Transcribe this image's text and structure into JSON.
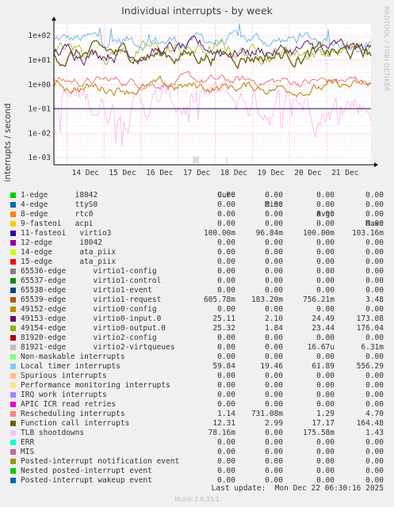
{
  "chart_data": {
    "type": "line",
    "title": "Individual interrupts - by week",
    "ylabel": "interrupts / second",
    "yscale": "log",
    "ylim": [
      0.0005,
      300
    ],
    "yticks": [
      "1e-03",
      "1e-02",
      "1e-01",
      "1e+00",
      "1e+01",
      "1e+02"
    ],
    "x_categories": [
      "14 Dec",
      "15 Dec",
      "16 Dec",
      "17 Dec",
      "18 Dec",
      "19 Dec",
      "20 Dec",
      "21 Dec"
    ],
    "grid": true,
    "legend_placement": "bottom",
    "series_traces": [
      {
        "name": "Local timer interrupts",
        "color": "#7ab6e8",
        "typical": 61.89,
        "noise": 0.18,
        "spike_max": 556.29
      },
      {
        "name": "TLB shootdowns",
        "color": "#ffbef0",
        "typical": 0.18,
        "noise": 0.45,
        "dips": true
      },
      {
        "name": "Rescheduling interrupts",
        "color": "#e9797a",
        "typical": 1.29,
        "noise": 0.14
      },
      {
        "name": "virtio0-output.0",
        "color": "#a8c447",
        "typical": 23.44,
        "noise": 0.22
      },
      {
        "name": "virtio0-input.0",
        "color": "#5d1c72",
        "typical": 24.49,
        "noise": 0.2
      },
      {
        "name": "Function call interrupts",
        "color": "#6f6417",
        "typical": 17.17,
        "noise": 0.22
      },
      {
        "name": "virtio1-request",
        "color": "#b5820a",
        "typical": 0.7562,
        "noise": 0.15
      },
      {
        "name": "virtio3",
        "color": "#1f0e63",
        "typical": 0.1,
        "noise": 0.0
      }
    ]
  },
  "legend_header": {
    "cur": "Cur:",
    "min": "Min:",
    "avg": "Avg:",
    "max": "Max:"
  },
  "legend": [
    {
      "name": "1-edge      i8042",
      "color": "#00cc00",
      "cur": "0.00",
      "min": "0.00",
      "avg": "0.00",
      "max": "0.00"
    },
    {
      "name": "4-edge      ttyS0",
      "color": "#0066b3",
      "cur": "0.00",
      "min": "0.00",
      "avg": "0.00",
      "max": "0.00"
    },
    {
      "name": "8-edge      rtc0",
      "color": "#ff8000",
      "cur": "0.00",
      "min": "0.00",
      "avg": "0.00",
      "max": "0.00"
    },
    {
      "name": "9-fasteoi   acpi",
      "color": "#ffcc00",
      "cur": "0.00",
      "min": "0.00",
      "avg": "0.00",
      "max": "0.00"
    },
    {
      "name": "11-fasteoi   virtio3",
      "color": "#330099",
      "cur": "100.00m",
      "min": "96.84m",
      "avg": "100.00m",
      "max": "103.16m"
    },
    {
      "name": "12-edge      i8042",
      "color": "#990099",
      "cur": "0.00",
      "min": "0.00",
      "avg": "0.00",
      "max": "0.00"
    },
    {
      "name": "14-edge      ata_piix",
      "color": "#ccff00",
      "cur": "0.00",
      "min": "0.00",
      "avg": "0.00",
      "max": "0.00"
    },
    {
      "name": "15-edge      ata_piix",
      "color": "#ff0000",
      "cur": "0.00",
      "min": "0.00",
      "avg": "0.00",
      "max": "0.00"
    },
    {
      "name": "65536-edge      virtio1-config",
      "color": "#808080",
      "cur": "0.00",
      "min": "0.00",
      "avg": "0.00",
      "max": "0.00"
    },
    {
      "name": "65537-edge      virtio1-control",
      "color": "#008f00",
      "cur": "0.00",
      "min": "0.00",
      "avg": "0.00",
      "max": "0.00"
    },
    {
      "name": "65538-edge      virtio1-event",
      "color": "#00487d",
      "cur": "0.00",
      "min": "0.00",
      "avg": "0.00",
      "max": "0.00"
    },
    {
      "name": "65539-edge      virtio1-request",
      "color": "#b35a00",
      "cur": "605.78m",
      "min": "183.20m",
      "avg": "756.21m",
      "max": "3.48"
    },
    {
      "name": "49152-edge      virtio0-config",
      "color": "#b38f00",
      "cur": "0.00",
      "min": "0.00",
      "avg": "0.00",
      "max": "0.00"
    },
    {
      "name": "49153-edge      virtio0-input.0",
      "color": "#6b006b",
      "cur": "25.11",
      "min": "2.10",
      "avg": "24.49",
      "max": "173.08"
    },
    {
      "name": "49154-edge      virtio0-output.0",
      "color": "#8fb300",
      "cur": "25.32",
      "min": "1.84",
      "avg": "23.44",
      "max": "176.04"
    },
    {
      "name": "81920-edge      virtio2-config",
      "color": "#b30000",
      "cur": "0.00",
      "min": "0.00",
      "avg": "0.00",
      "max": "0.00"
    },
    {
      "name": "81921-edge      virtio2-virtqueues",
      "color": "#bebebe",
      "cur": "0.00",
      "min": "0.00",
      "avg": "16.67u",
      "max": "6.31m"
    },
    {
      "name": "Non-maskable interrupts",
      "color": "#80ff80",
      "cur": "0.00",
      "min": "0.00",
      "avg": "0.00",
      "max": "0.00"
    },
    {
      "name": "Local timer interrupts",
      "color": "#80c9ff",
      "cur": "59.84",
      "min": "19.46",
      "avg": "61.89",
      "max": "556.29"
    },
    {
      "name": "Spurious interrupts",
      "color": "#ffc080",
      "cur": "0.00",
      "min": "0.00",
      "avg": "0.00",
      "max": "0.00"
    },
    {
      "name": "Performance monitoring interrupts",
      "color": "#ffe680",
      "cur": "0.00",
      "min": "0.00",
      "avg": "0.00",
      "max": "0.00"
    },
    {
      "name": "IRQ work interrupts",
      "color": "#aa80ff",
      "cur": "0.00",
      "min": "0.00",
      "avg": "0.00",
      "max": "0.00"
    },
    {
      "name": "APIC ICR read retries",
      "color": "#ee00cc",
      "cur": "0.00",
      "min": "0.00",
      "avg": "0.00",
      "max": "0.00"
    },
    {
      "name": "Rescheduling interrupts",
      "color": "#ff8080",
      "cur": "1.14",
      "min": "731.08m",
      "avg": "1.29",
      "max": "4.70"
    },
    {
      "name": "Function call interrupts",
      "color": "#666600",
      "cur": "12.31",
      "min": "2.99",
      "avg": "17.17",
      "max": "164.48"
    },
    {
      "name": "TLB shootdowns",
      "color": "#ffbfff",
      "cur": "78.16m",
      "min": "0.00",
      "avg": "175.58m",
      "max": "1.43"
    },
    {
      "name": "ERR",
      "color": "#00ffcc",
      "cur": "0.00",
      "min": "0.00",
      "avg": "0.00",
      "max": "0.00"
    },
    {
      "name": "MIS",
      "color": "#cc6699",
      "cur": "0.00",
      "min": "0.00",
      "avg": "0.00",
      "max": "0.00"
    },
    {
      "name": "Posted-interrupt notification event",
      "color": "#999900",
      "cur": "0.00",
      "min": "0.00",
      "avg": "0.00",
      "max": "0.00"
    },
    {
      "name": "Nested posted-interrupt event",
      "color": "#00cc00",
      "cur": "0.00",
      "min": "0.00",
      "avg": "0.00",
      "max": "0.00"
    },
    {
      "name": "Posted-interrupt wakeup event",
      "color": "#0066b3",
      "cur": "0.00",
      "min": "0.00",
      "avg": "0.00",
      "max": "0.00"
    }
  ],
  "last_update": "Last update:  Mon Dec 22 06:30:16 2025",
  "footer": "Munin 2.0.33-1",
  "watermark": "RRDTOOL / TOBI OETIKER"
}
